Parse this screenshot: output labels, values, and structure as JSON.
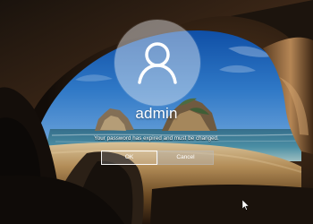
{
  "screen": {
    "user_name": "admin",
    "message": "Your password has expired and must be changed.",
    "ok_label": "OK",
    "cancel_label": "Cancel"
  },
  "icons": {
    "avatar": "user-avatar-icon",
    "pointer": "mouse-pointer-icon"
  },
  "colors": {
    "text": "#ffffff",
    "ok_border": "#ffffff",
    "cancel_fill": "#b9b9b9"
  }
}
